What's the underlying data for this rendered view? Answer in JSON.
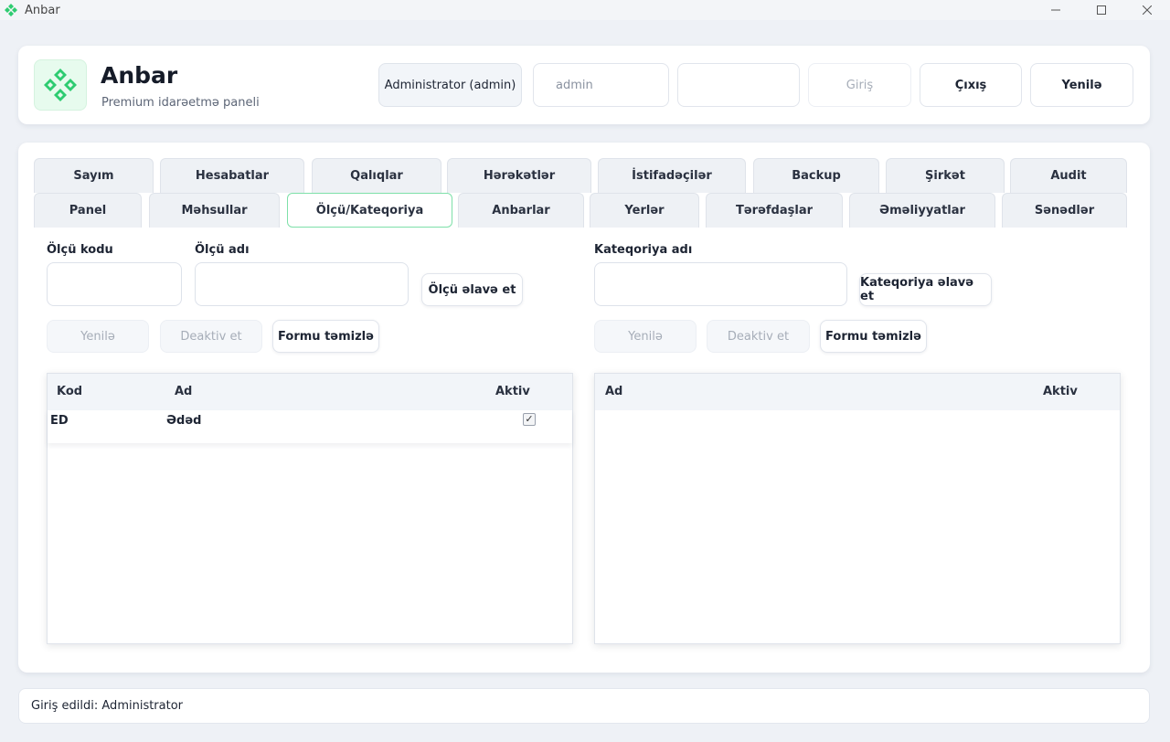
{
  "window": {
    "title": "Anbar",
    "accent_color": "#2ecc71",
    "icons": {
      "minimize": "minimize-icon",
      "maximize": "maximize-icon",
      "close": "close-icon"
    }
  },
  "header": {
    "app_name": "Anbar",
    "subtitle": "Premium idarəetmə paneli",
    "user_pill": "Administrator (admin)",
    "username_value": "admin",
    "password_value": "",
    "login_label": "Giriş",
    "logout_label": "Çıxış",
    "refresh_label": "Yenilə"
  },
  "tabs": {
    "row1": [
      "Sayım",
      "Hesabatlar",
      "Qalıqlar",
      "Hərəkətlər",
      "İstifadəçilər",
      "Backup",
      "Şirkət",
      "Audit"
    ],
    "row2": [
      "Panel",
      "Məhsullar",
      "Ölçü/Kateqoriya",
      "Anbarlar",
      "Yerlər",
      "Tərəfdaşlar",
      "Əməliyyatlar",
      "Sənədlər"
    ],
    "active": "Ölçü/Kateqoriya"
  },
  "units": {
    "code_label": "Ölçü kodu",
    "name_label": "Ölçü adı",
    "code_value": "",
    "name_value": "",
    "add_label": "Ölçü əlavə et",
    "refresh_label": "Yenilə",
    "deactivate_label": "Deaktiv et",
    "clear_label": "Formu təmizlə",
    "columns": [
      "Kod",
      "Ad",
      "Aktiv"
    ],
    "rows": [
      {
        "code": "ED",
        "name": "Ədəd",
        "active": true
      }
    ]
  },
  "categories": {
    "name_label": "Kateqoriya adı",
    "name_value": "",
    "add_label": "Kateqoriya əlavə et",
    "refresh_label": "Yenilə",
    "deactivate_label": "Deaktiv et",
    "clear_label": "Formu təmizlə",
    "columns": [
      "Ad",
      "Aktiv"
    ],
    "rows": []
  },
  "status": {
    "text": "Giriş edildi: Administrator"
  }
}
